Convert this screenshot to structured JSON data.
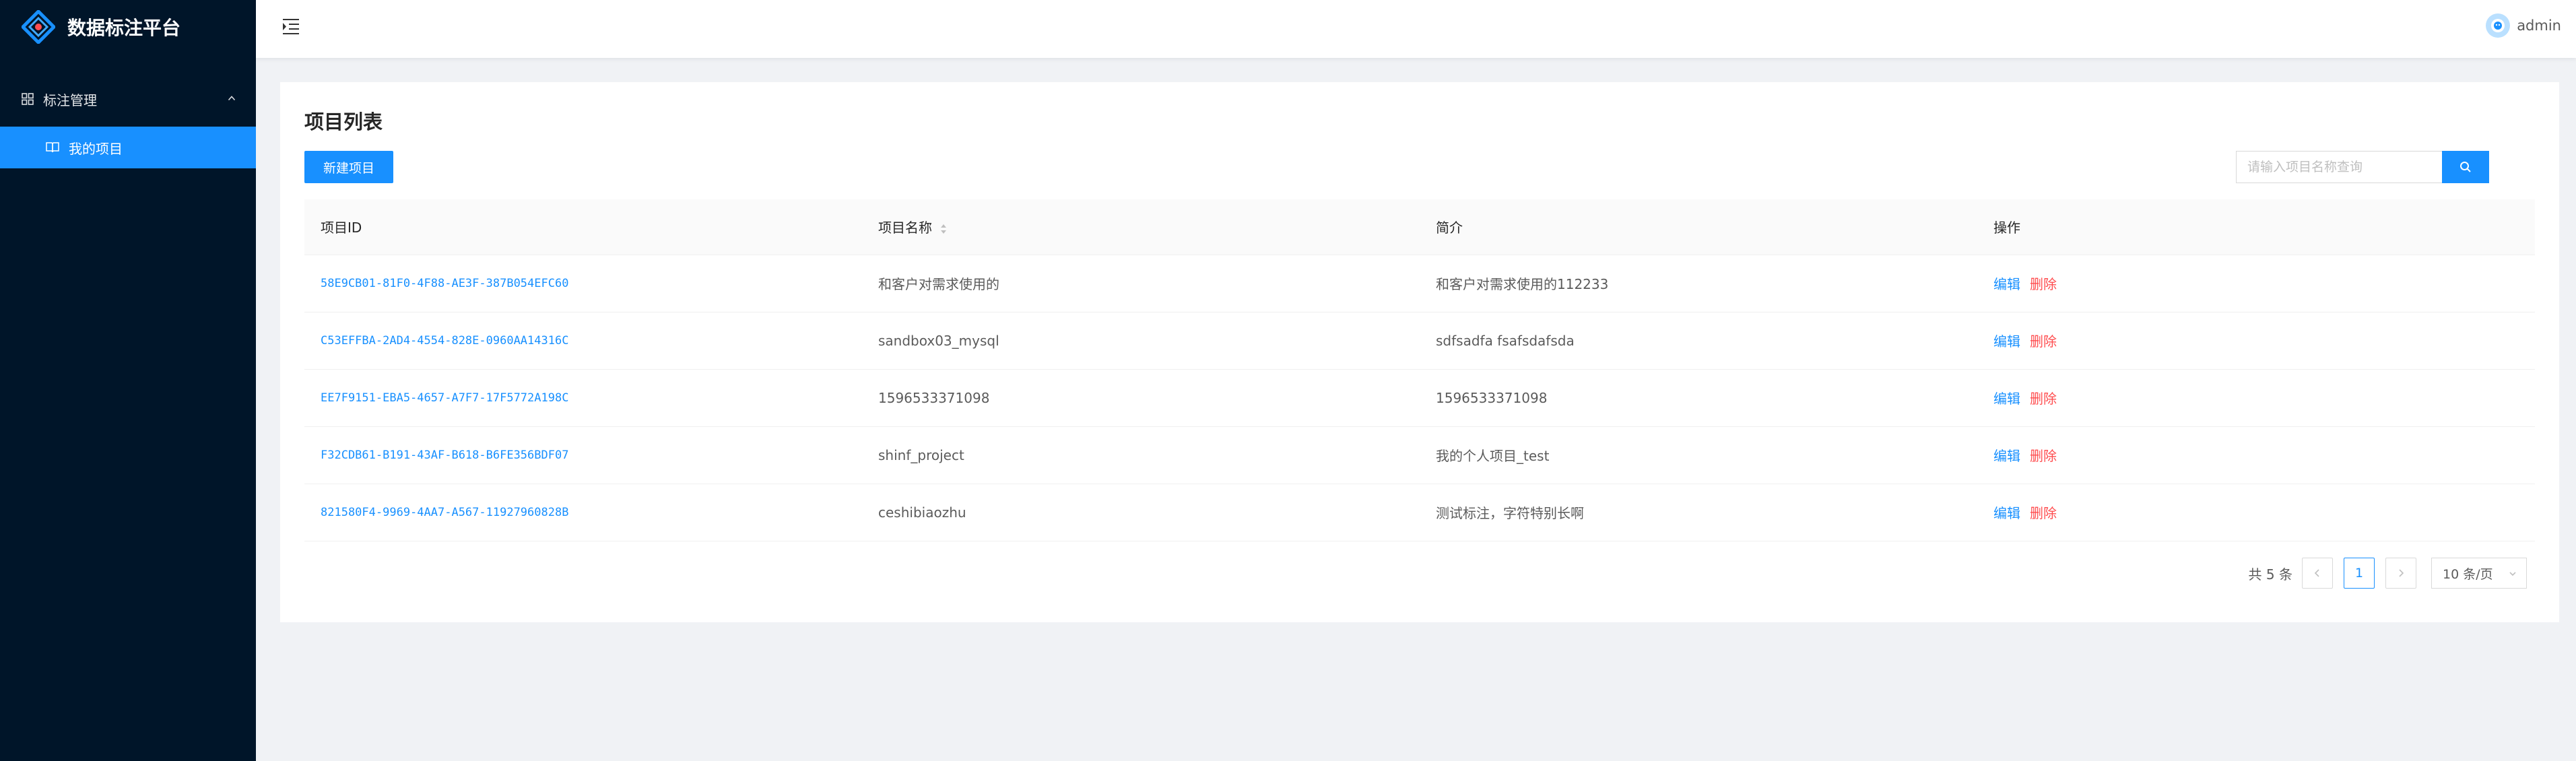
{
  "app": {
    "title": "数据标注平台",
    "accent": "#1890ff",
    "sider_bg": "#001529",
    "danger": "#ff4d4f"
  },
  "sidebar": {
    "group": {
      "label": "标注管理",
      "icon": "appstore-icon",
      "expanded": true
    },
    "items": [
      {
        "label": "我的项目",
        "icon": "book-icon",
        "active": true
      }
    ]
  },
  "header": {
    "fold_icon": "menu-fold-icon",
    "user": {
      "name": "admin",
      "icon": "avatar-icon"
    }
  },
  "main": {
    "title": "项目列表",
    "new_button_label": "新建项目",
    "search": {
      "placeholder": "请输入项目名称查询",
      "value": "",
      "icon": "search-icon"
    },
    "table": {
      "columns": [
        "项目ID",
        "项目名称",
        "简介",
        "操作"
      ],
      "rows": [
        {
          "id": "58E9CB01-81F0-4F88-AE3F-387B054EFC60",
          "name": "和客户对需求使用的",
          "desc": "和客户对需求使用的112233"
        },
        {
          "id": "C53EFFBA-2AD4-4554-828E-0960AA14316C",
          "name": "sandbox03_mysql",
          "desc": "sdfsadfa fsafsdafsda"
        },
        {
          "id": "EE7F9151-EBA5-4657-A7F7-17F5772A198C",
          "name": "1596533371098",
          "desc": "1596533371098"
        },
        {
          "id": "F32CDB61-B191-43AF-B618-B6FE356BDF07",
          "name": "shinf_project",
          "desc": "我的个人项目_test"
        },
        {
          "id": "821580F4-9969-4AA7-A567-11927960828B",
          "name": "ceshibiaozhu",
          "desc": "测试标注，字符特别长啊"
        }
      ],
      "actions": {
        "edit": "编辑",
        "delete": "删除"
      }
    },
    "pagination": {
      "total_text": "共 5 条",
      "current_page": "1",
      "page_size": "10 条/页"
    }
  }
}
